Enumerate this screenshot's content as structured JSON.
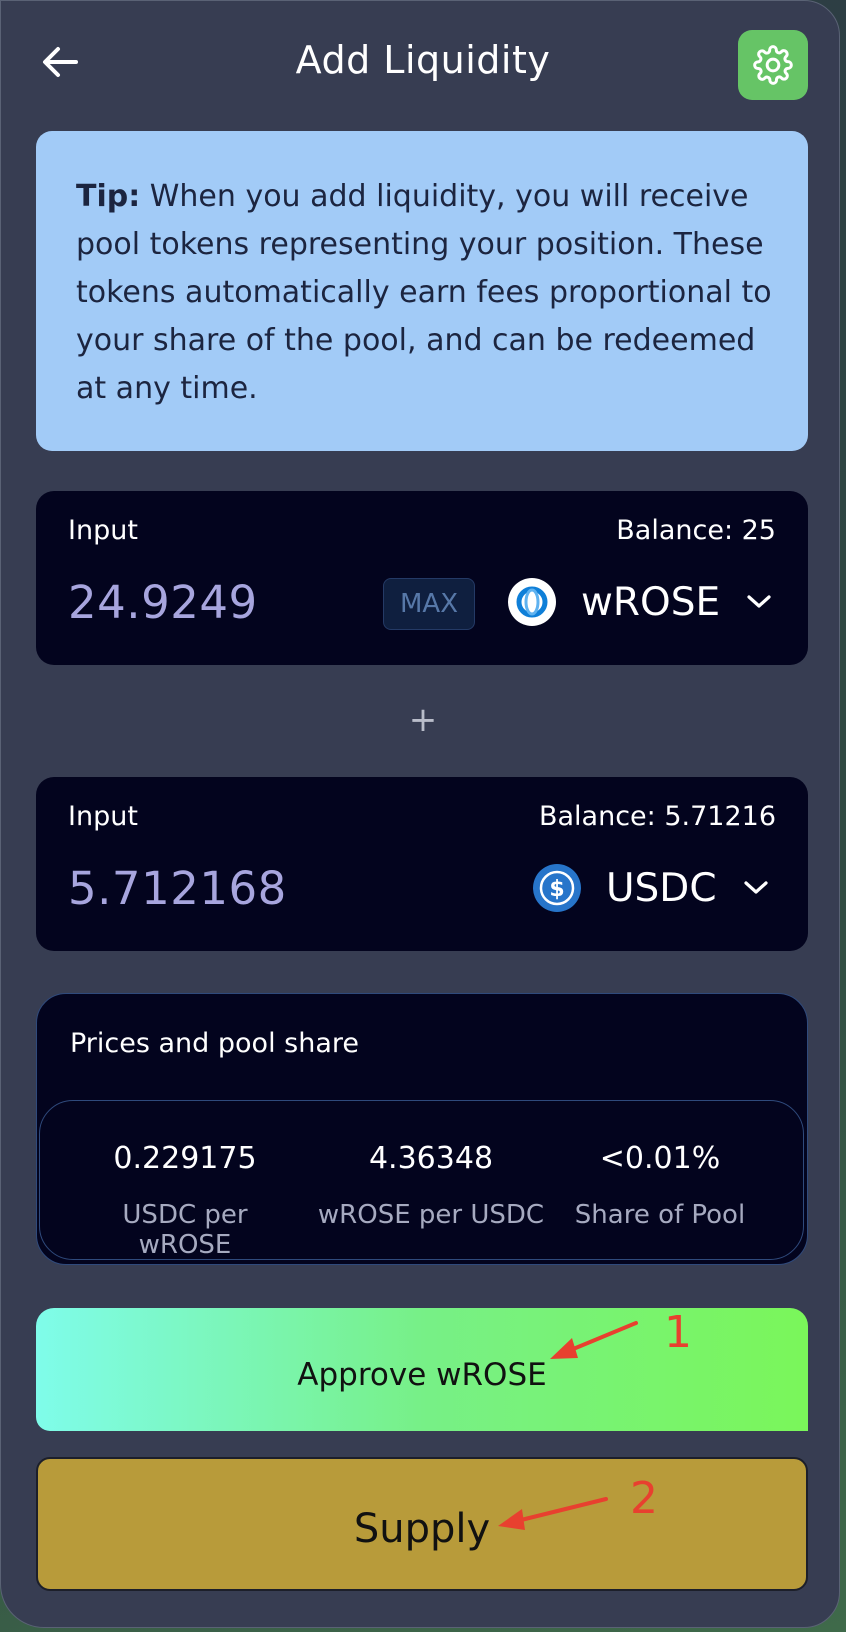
{
  "header": {
    "title": "Add Liquidity"
  },
  "tip": {
    "bold": "Tip:",
    "text": " When you add liquidity, you will receive pool tokens representing your position. These tokens automatically earn fees proportional to your share of the pool, and can be redeemed at any time."
  },
  "inputs": [
    {
      "label": "Input",
      "balance": "Balance: 25",
      "amount": "24.9249",
      "max_label": "MAX",
      "token": "wROSE",
      "icon": "wrose-token-icon"
    },
    {
      "label": "Input",
      "balance": "Balance: 5.71216",
      "amount": "5.712168",
      "token": "USDC",
      "icon": "usdc-token-icon"
    }
  ],
  "separator": "+",
  "prices": {
    "title": "Prices and pool share",
    "stats": [
      {
        "value": "0.229175",
        "label": "USDC per wROSE"
      },
      {
        "value": "4.36348",
        "label": "wROSE per USDC"
      },
      {
        "value": "<0.01%",
        "label": "Share of Pool"
      }
    ]
  },
  "buttons": {
    "approve": "Approve wROSE",
    "supply": "Supply"
  },
  "annotations": {
    "one": "1",
    "two": "2"
  },
  "colors": {
    "panel": "#373d52",
    "card": "#03041e",
    "tip_bg": "#a2cbf7",
    "settings": "#66c466",
    "supply": "#b89b3a",
    "annotation": "#e8402f"
  }
}
